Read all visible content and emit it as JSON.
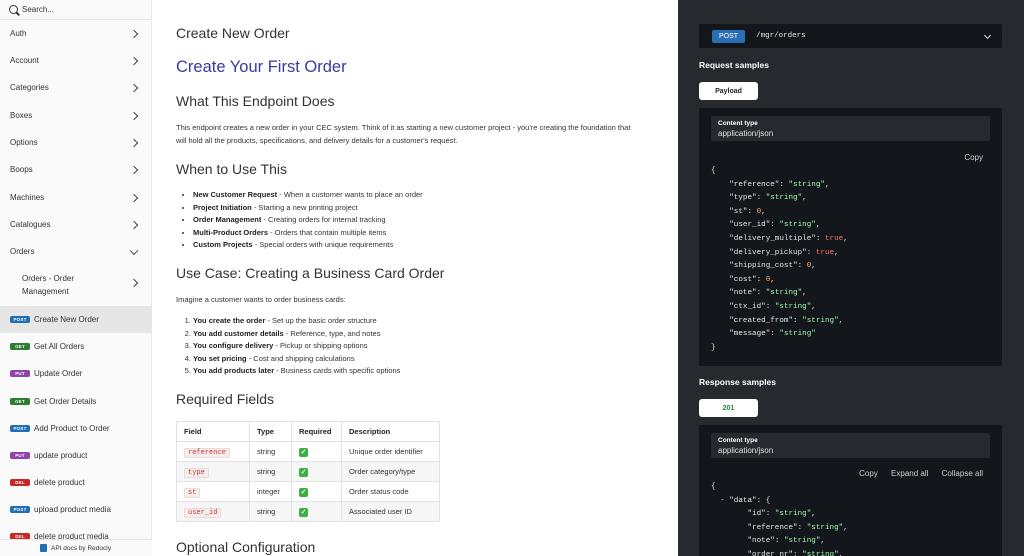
{
  "sidebar": {
    "search_placeholder": "Search...",
    "groups": [
      {
        "label": "Auth"
      },
      {
        "label": "Account"
      },
      {
        "label": "Categories"
      },
      {
        "label": "Boxes"
      },
      {
        "label": "Options"
      },
      {
        "label": "Boops"
      },
      {
        "label": "Machines"
      },
      {
        "label": "Catalogues"
      },
      {
        "label": "Orders"
      }
    ],
    "subgroup": {
      "line1": "Orders - Order",
      "line2": "Management"
    },
    "endpoints": [
      {
        "method": "POST",
        "label": "Create New Order",
        "active": true
      },
      {
        "method": "GET",
        "label": "Get All Orders"
      },
      {
        "method": "PUT",
        "label": "Update Order"
      },
      {
        "method": "GET",
        "label": "Get Order Details"
      },
      {
        "method": "POST",
        "label": "Add Product to Order"
      },
      {
        "method": "PUT",
        "label": "update product"
      },
      {
        "method": "DEL",
        "label": "delete product"
      },
      {
        "method": "POST",
        "label": "upload product media"
      },
      {
        "method": "DEL",
        "label": "delete product media"
      }
    ],
    "footer": "API docs by Redocly"
  },
  "content": {
    "endpoint_title": "Create New Order",
    "main_title": "Create Your First Order",
    "what_heading": "What This Endpoint Does",
    "what_para": "This endpoint creates a new order in your CEC system. Think of it as starting a new customer project - you're creating the foundation that will hold all the products, specifications, and delivery details for a customer's request.",
    "when_heading": "When to Use This",
    "when_items": [
      {
        "bold": "New Customer Request",
        "text": " - When a customer wants to place an order"
      },
      {
        "bold": "Project Initiation",
        "text": " - Starting a new printing project"
      },
      {
        "bold": "Order Management",
        "text": " - Creating orders for internal tracking"
      },
      {
        "bold": "Multi-Product Orders",
        "text": " - Orders that contain multiple items"
      },
      {
        "bold": "Custom Projects",
        "text": " - Special orders with unique requirements"
      }
    ],
    "usecase_heading": "Use Case: Creating a Business Card Order",
    "usecase_para": "Imagine a customer wants to order business cards:",
    "steps": [
      {
        "bold": "You create the order",
        "text": " - Set up the basic order structure"
      },
      {
        "bold": "You add customer details",
        "text": " - Reference, type, and notes"
      },
      {
        "bold": "You configure delivery",
        "text": " - Pickup or shipping options"
      },
      {
        "bold": "You set pricing",
        "text": " - Cost and shipping calculations"
      },
      {
        "bold": "You add products later",
        "text": " - Business cards with specific options"
      }
    ],
    "required_heading": "Required Fields",
    "table": {
      "headers": [
        "Field",
        "Type",
        "Required",
        "Description"
      ],
      "rows": [
        {
          "field": "reference",
          "type": "string",
          "required": "✓",
          "desc": "Unique order identifier"
        },
        {
          "field": "type",
          "type": "string",
          "required": "✓",
          "desc": "Order category/type"
        },
        {
          "field": "st",
          "type": "integer",
          "required": "✓",
          "desc": "Order status code"
        },
        {
          "field": "user_id",
          "type": "string",
          "required": "✓",
          "desc": "Associated user ID"
        }
      ]
    },
    "optional_heading": "Optional Configuration"
  },
  "right": {
    "method": "POST",
    "path": "/mgr/orders",
    "request_title": "Request samples",
    "request_tab": "Payload",
    "content_type_label": "Content type",
    "content_type_value": "application/json",
    "copy": "Copy",
    "response_title": "Response samples",
    "response_tab": "201",
    "response_content_type_label": "Content type",
    "response_content_type_value": "application/json",
    "r_copy": "Copy",
    "expand_all": "Expand all",
    "collapse_all": "Collapse all",
    "request_body": [
      {
        "key": "reference",
        "value": "\"string\"",
        "kind": "str"
      },
      {
        "key": "type",
        "value": "\"string\"",
        "kind": "str"
      },
      {
        "key": "st",
        "value": "0",
        "kind": "num"
      },
      {
        "key": "user_id",
        "value": "\"string\"",
        "kind": "str"
      },
      {
        "key": "delivery_multiple",
        "value": "true",
        "kind": "bool"
      },
      {
        "key": "delivery_pickup",
        "value": "true",
        "kind": "bool"
      },
      {
        "key": "shipping_cost",
        "value": "0",
        "kind": "num"
      },
      {
        "key": "cost",
        "value": "0",
        "kind": "num"
      },
      {
        "key": "note",
        "value": "\"string\"",
        "kind": "str"
      },
      {
        "key": "ctx_id",
        "value": "\"string\"",
        "kind": "str"
      },
      {
        "key": "created_from",
        "value": "\"string\"",
        "kind": "str"
      },
      {
        "key": "message",
        "value": "\"string\"",
        "kind": "str"
      }
    ],
    "response_body": [
      {
        "key": "id",
        "value": "\"string\"",
        "kind": "str"
      },
      {
        "key": "reference",
        "value": "\"string\"",
        "kind": "str"
      },
      {
        "key": "note",
        "value": "\"string\"",
        "kind": "str"
      },
      {
        "key": "order_nr",
        "value": "\"string\"",
        "kind": "str"
      }
    ],
    "response_data_key": "data"
  },
  "colors": {
    "accent_title": "#3b3aa0",
    "right_panel_bg": "#262a2f",
    "code_bg": "#13171b",
    "string_green": "#a0fbaa",
    "number_orange": "#ffa86b",
    "bool_red": "#ff6e6e"
  }
}
